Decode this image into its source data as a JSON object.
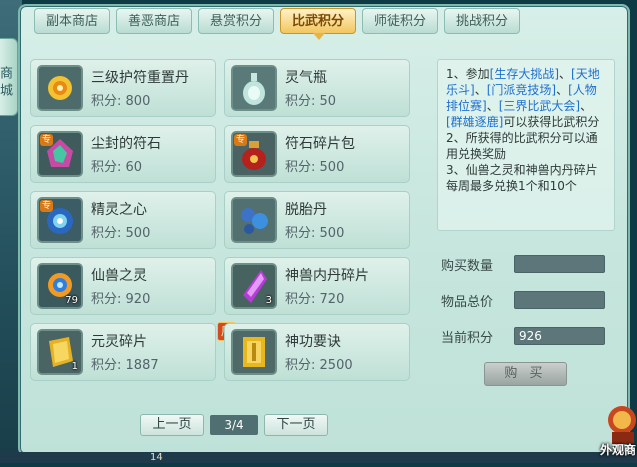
{
  "left_tab": {
    "label": "商\n城"
  },
  "tabs": [
    {
      "label": "副本商店",
      "active": false
    },
    {
      "label": "善恶商店",
      "active": false
    },
    {
      "label": "悬赏积分",
      "active": false
    },
    {
      "label": "比武积分",
      "active": true
    },
    {
      "label": "师徒积分",
      "active": false
    },
    {
      "label": "挑战积分",
      "active": false
    }
  ],
  "price_prefix": "积分:",
  "items": [
    {
      "name": "三级护符重置丹",
      "price": "800",
      "icon": "golden-talisman-icon"
    },
    {
      "name": "灵气瓶",
      "price": "50",
      "icon": "spirit-bottle-icon"
    },
    {
      "name": "尘封的符石",
      "price": "60",
      "icon": "rune-stone-icon",
      "badge": "专"
    },
    {
      "name": "符石碎片包",
      "price": "500",
      "icon": "rune-bag-icon",
      "badge": "专"
    },
    {
      "name": "精灵之心",
      "price": "500",
      "icon": "elf-heart-icon",
      "badge": "专"
    },
    {
      "name": "脱胎丹",
      "price": "500",
      "icon": "transform-pill-icon"
    },
    {
      "name": "仙兽之灵",
      "price": "920",
      "icon": "beast-spirit-icon",
      "count": "79"
    },
    {
      "name": "神兽内丹碎片",
      "price": "720",
      "icon": "crystal-shard-icon",
      "count": "3"
    },
    {
      "name": "元灵碎片",
      "price": "1887",
      "icon": "gold-fragment-icon",
      "count": "1",
      "week_badge": "周"
    },
    {
      "name": "神功要诀",
      "price": "2500",
      "icon": "golden-book-icon"
    }
  ],
  "pager": {
    "prev": "上一页",
    "page": "3/4",
    "next": "下一页"
  },
  "info": {
    "line1_a": "1、参加",
    "link1": "[生存大挑战]",
    "sep1": "、",
    "link2": "[天地乐斗]",
    "sep2": "、",
    "link3": "[门派竞技场]",
    "sep3": "、",
    "link4": "[人物排位赛]",
    "sep4": "、",
    "link5": "[三界比武大会]",
    "sep5": "、",
    "link6": "[群雄逐鹿]",
    "line1_b": "可以获得比武积分",
    "line2": "2、所获得的比武积分可以通用兑换奖励",
    "line3": "3、仙兽之灵和神兽内丹碎片每周最多兑换1个和10个"
  },
  "form": {
    "qty_label": "购买数量",
    "qty_value": "",
    "total_label": "物品总价",
    "total_value": "",
    "points_label": "当前积分",
    "points_value": "926",
    "buy_label": "购 买"
  },
  "corner": {
    "label": "外观商"
  },
  "bottom": {
    "num": "14"
  }
}
